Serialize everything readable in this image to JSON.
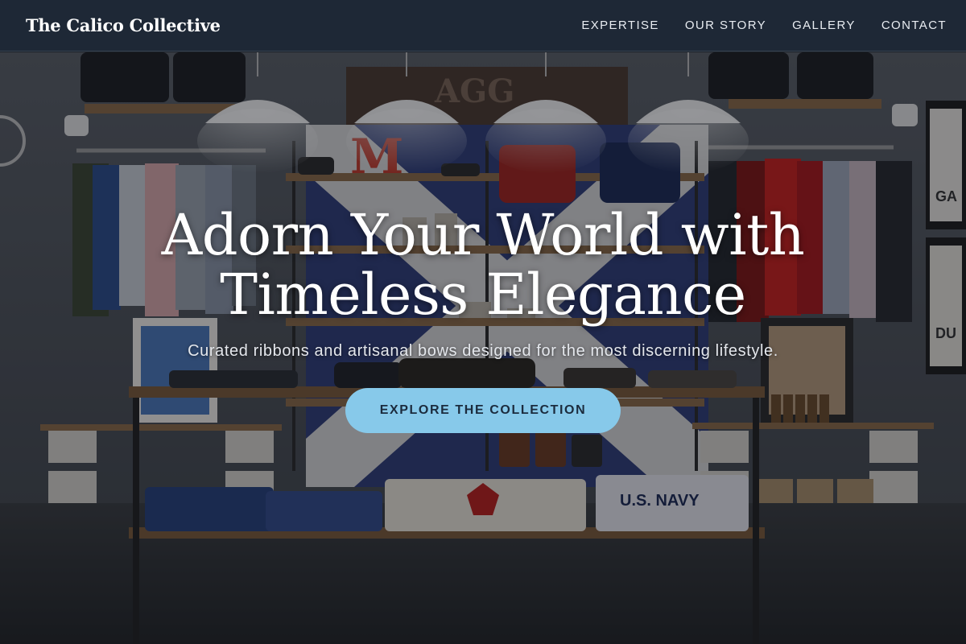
{
  "brand": {
    "name": "The Calico Collective"
  },
  "nav": {
    "items": [
      {
        "label": "EXPERTISE"
      },
      {
        "label": "OUR STORY"
      },
      {
        "label": "GALLERY"
      },
      {
        "label": "CONTACT"
      }
    ]
  },
  "hero": {
    "title_line1": "Adorn Your World with",
    "title_line2": "Timeless Elegance",
    "subtitle": "Curated ribbons and artisanal bows designed for the most discerning lifestyle.",
    "cta_label": "EXPLORE THE COLLECTION",
    "background_sign_text": "AGG",
    "background_letter": "M",
    "shirt_text": "U.S. NAVY"
  },
  "colors": {
    "navbar_bg": "#1e2836",
    "cta_bg": "#87c9ea",
    "cta_text": "#1b2b3d",
    "text_primary": "#ffffff"
  }
}
